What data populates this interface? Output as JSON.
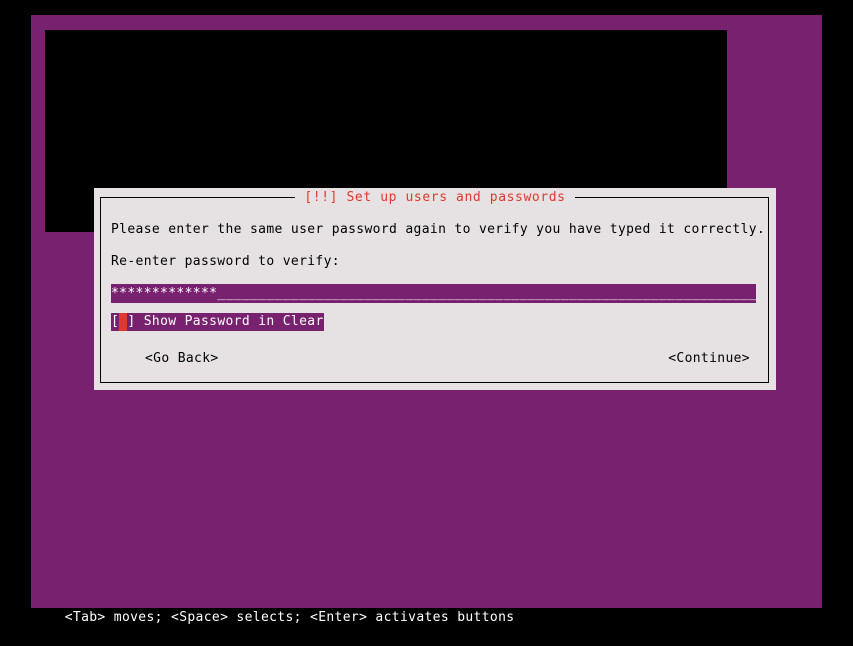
{
  "screen": {
    "background_color": "#000000",
    "terminal_background_color": "#77216f"
  },
  "dialog": {
    "title": "[!!] Set up users and passwords",
    "title_color": "#df382c",
    "background_color": "#e6e2e4",
    "intro_text": "Please enter the same user password again to verify you have typed it correctly.",
    "prompt_label": "Re-enter password to verify:",
    "password_field": {
      "masked_value": "*************",
      "filler": "_____________________________________________________________________",
      "background_color": "#77216f",
      "text_color": "#ffffff"
    },
    "show_password_checkbox": {
      "open_bracket": "[",
      "cursor": " ",
      "close_bracket": "]",
      "label": " Show Password in Clear",
      "checked": false,
      "highlight_color": "#77216f",
      "cursor_color": "#df382c"
    },
    "buttons": {
      "go_back": "<Go Back>",
      "continue": "<Continue>"
    }
  },
  "status_bar": {
    "text": "<Tab> moves; <Space> selects; <Enter> activates buttons"
  }
}
